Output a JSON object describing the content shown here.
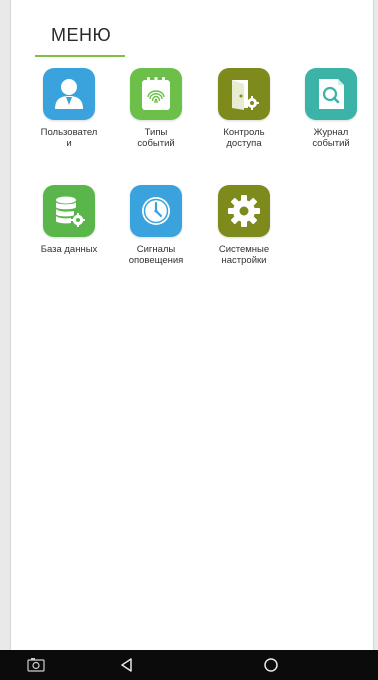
{
  "header": {
    "title": "МЕНЮ"
  },
  "menu": {
    "items": [
      {
        "label": "Пользовател\nи",
        "icon": "user-icon",
        "color": "#3aa3dd"
      },
      {
        "label": "Типы\nсобытий",
        "icon": "fingerprint-calendar-icon",
        "color": "#6cc04a"
      },
      {
        "label": "Контроль\nдоступа",
        "icon": "door-gear-icon",
        "color": "#7f8a1d"
      },
      {
        "label": "Журнал\nсобытий",
        "icon": "search-document-icon",
        "color": "#3bb3a6"
      },
      {
        "label": "База данных",
        "icon": "database-gear-icon",
        "color": "#5ab64a"
      },
      {
        "label": "Сигналы\nоповещения",
        "icon": "clock-icon",
        "color": "#3aa3dd"
      },
      {
        "label": "Системные\nнастройки",
        "icon": "gear-icon",
        "color": "#7f8a1d"
      }
    ]
  },
  "navbar": {
    "buttons": [
      {
        "icon": "screenshot-icon"
      },
      {
        "icon": "back-icon"
      },
      {
        "icon": "home-icon"
      }
    ]
  },
  "colors": {
    "accent": "#7fbf3f",
    "navbar": "#0b0b0b",
    "background": "#ffffff"
  }
}
